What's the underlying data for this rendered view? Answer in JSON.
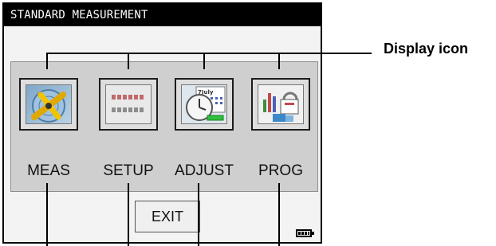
{
  "window": {
    "title": "STANDARD MEASUREMENT"
  },
  "icons": [
    {
      "label": "MEAS",
      "icon": "measure-instrument-icon"
    },
    {
      "label": "SETUP",
      "icon": "settings-grid-icon"
    },
    {
      "label": "ADJUST",
      "icon": "calendar-clock-icon"
    },
    {
      "label": "PROG",
      "icon": "programs-chart-icon"
    }
  ],
  "icon_calendar_text": "7July",
  "exit_label": "EXIT",
  "status": {
    "battery_icon": "battery-icon"
  },
  "annotation": {
    "display_icon_label": "Display icon"
  }
}
